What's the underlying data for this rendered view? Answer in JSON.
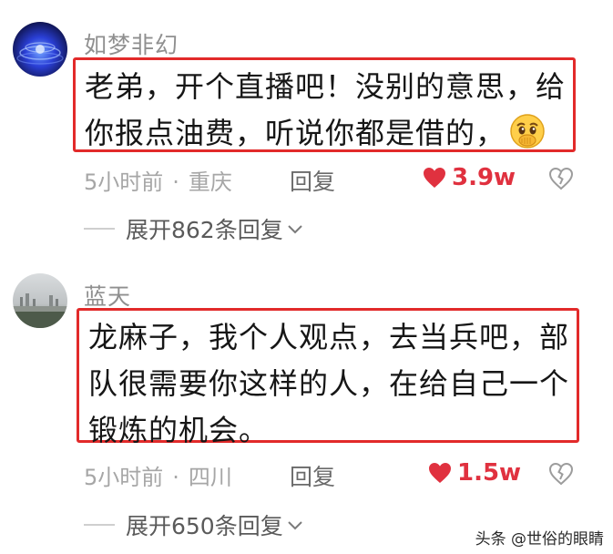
{
  "comments": [
    {
      "username": "如梦非幻",
      "text": "老弟，开个直播吧！没别的意思，给你报点油费，听说你都是借的，",
      "emoji": "covering-mouth-emoji",
      "time": "5小时前",
      "location": "重庆",
      "separator": "·",
      "reply_label": "回复",
      "likes": "3.9w",
      "expand_label": "展开862条回复"
    },
    {
      "username": "蓝天",
      "text": "龙麻子，我个人观点，去当兵吧，部队很需要你这样的人，在给自己一个锻炼的机会。",
      "time": "5小时前",
      "location": "四川",
      "separator": "·",
      "reply_label": "回复",
      "likes": "1.5w",
      "expand_label": "展开650条回复"
    }
  ],
  "icons": {
    "like": "heart-icon",
    "dislike": "broken-heart-icon",
    "expand": "chevron-down-icon"
  },
  "colors": {
    "highlight_border": "#e22a2a",
    "like": "#e0313f",
    "muted_text": "#a6a6a6"
  },
  "watermark": "头条 @世俗的眼睛"
}
